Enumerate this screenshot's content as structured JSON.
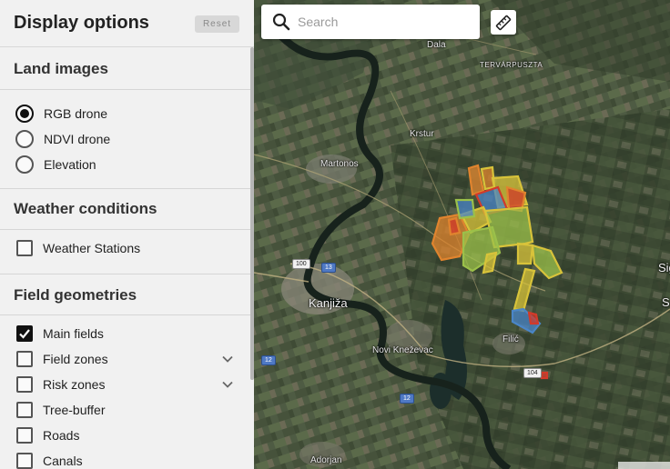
{
  "sidebar": {
    "title": "Display options",
    "reset_label": "Reset",
    "land_images": {
      "title": "Land images",
      "options": [
        {
          "label": "RGB drone",
          "selected": true
        },
        {
          "label": "NDVI drone",
          "selected": false
        },
        {
          "label": "Elevation",
          "selected": false
        }
      ]
    },
    "weather": {
      "title": "Weather conditions",
      "options": [
        {
          "label": "Weather Stations",
          "checked": false
        }
      ]
    },
    "geometries": {
      "title": "Field geometries",
      "options": [
        {
          "label": "Main fields",
          "checked": true,
          "expandable": false
        },
        {
          "label": "Field zones",
          "checked": false,
          "expandable": true
        },
        {
          "label": "Risk zones",
          "checked": false,
          "expandable": true
        },
        {
          "label": "Tree-buffer",
          "checked": false,
          "expandable": false
        },
        {
          "label": "Roads",
          "checked": false,
          "expandable": false
        },
        {
          "label": "Canals",
          "checked": false,
          "expandable": false
        }
      ]
    }
  },
  "map": {
    "search_placeholder": "Search",
    "places": {
      "dala": "Dala",
      "tervarpuszta": "TERVÁRPUSZTA",
      "krstur": "Krstur",
      "martonos": "Martonos",
      "kanjiza": "Kanjiža",
      "novi_knezevac": "Novi Kneževac",
      "filic": "Filić",
      "adorjan": "Adorjan",
      "sig": "Sig",
      "s_edge": "S"
    },
    "road_shields": {
      "r100": "100",
      "r13": "13",
      "r104": "104",
      "r12a": "12",
      "r12b": "12"
    },
    "colors": {
      "yellow": "#d8c33a",
      "green": "#9bc04a",
      "orange": "#e0842e",
      "blue": "#4a86c8",
      "red": "#d23a2a"
    },
    "icons": {
      "search": "search-icon",
      "ruler": "ruler-icon"
    }
  }
}
